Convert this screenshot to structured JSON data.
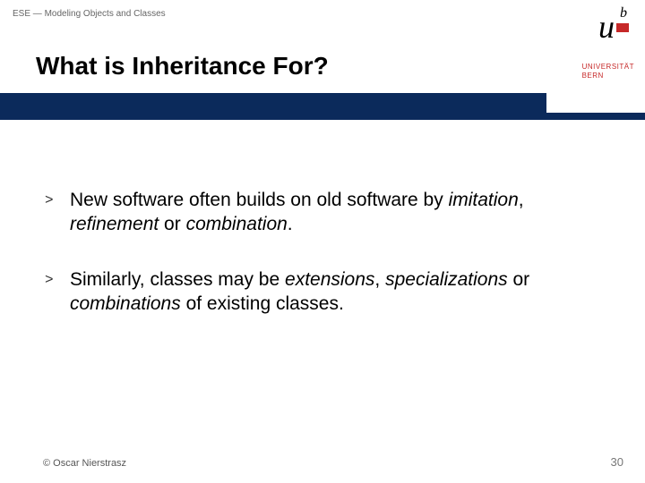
{
  "breadcrumb": "ESE — Modeling Objects and Classes",
  "title": "What is Inheritance For?",
  "logo": {
    "u": "u",
    "b": "b",
    "uni1": "UNIVERSITÄT",
    "uni2": "BERN"
  },
  "bullets": [
    {
      "marker": ">",
      "pre1": "New software often builds on old software by ",
      "it1": "imitation",
      "mid1": ", ",
      "it2": "refinement",
      "mid2": " or ",
      "it3": "combination",
      "post": "."
    },
    {
      "marker": ">",
      "pre1": "Similarly, classes may be ",
      "it1": "extensions",
      "mid1": ", ",
      "it2": "specializations",
      "mid2": " or ",
      "it3": "combinations",
      "post": " of existing classes."
    }
  ],
  "footer": {
    "left": "© Oscar Nierstrasz",
    "right": "30"
  }
}
